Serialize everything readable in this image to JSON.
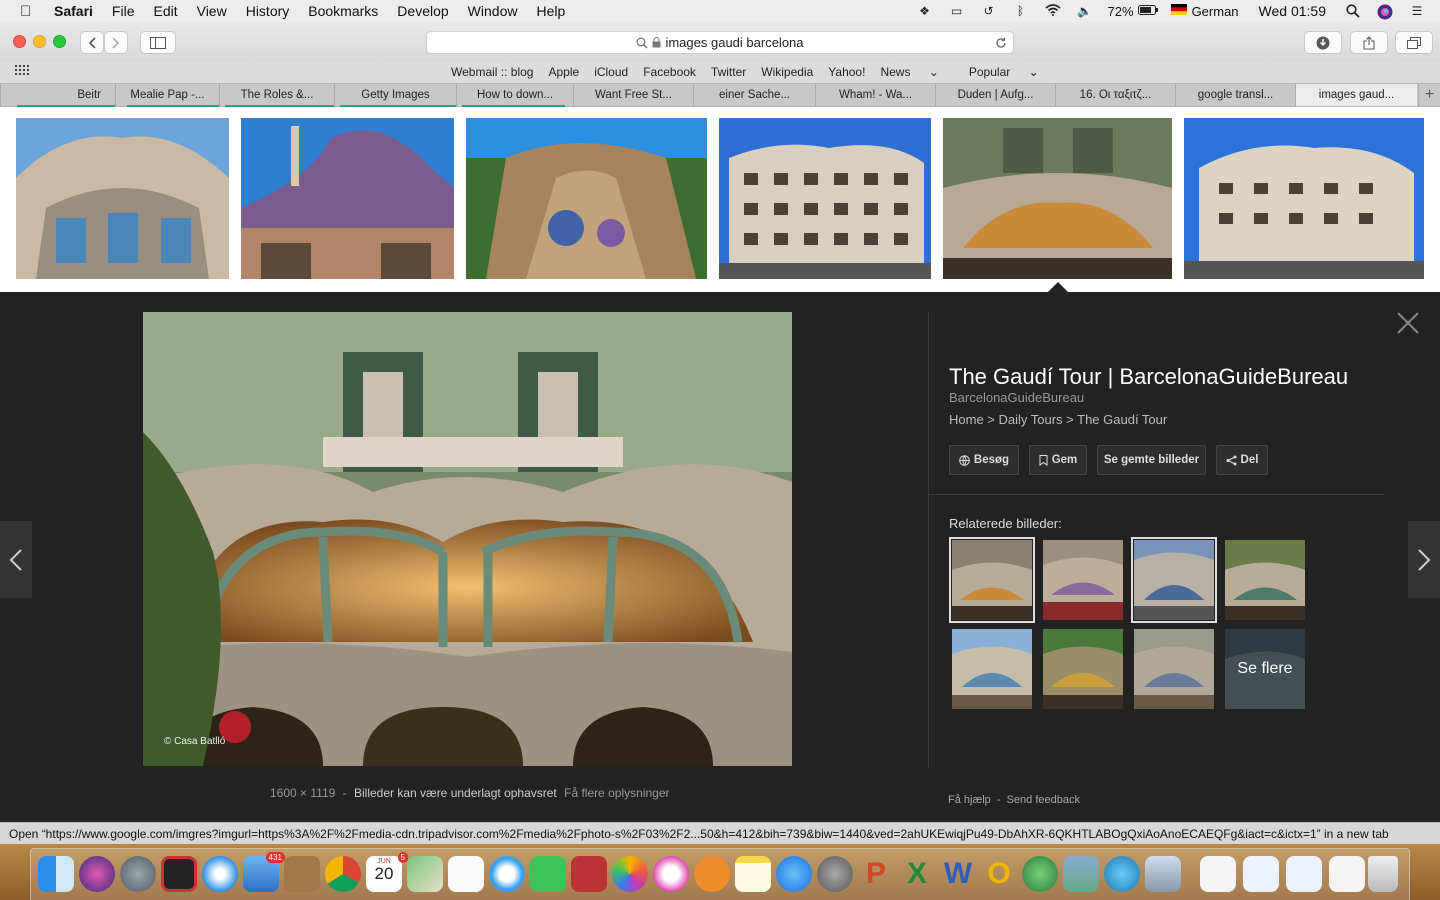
{
  "menubar": {
    "app": "Safari",
    "items": [
      "File",
      "Edit",
      "View",
      "History",
      "Bookmarks",
      "Develop",
      "Window",
      "Help"
    ],
    "battery": "72%",
    "input_source": "German",
    "clock": "Wed 01:59"
  },
  "toolbar": {
    "url_text": "images gaudi barcelona"
  },
  "favorites": [
    "Webmail :: blog",
    "Apple",
    "iCloud",
    "Facebook",
    "Twitter",
    "Wikipedia",
    "Yahoo!",
    "News",
    "Popular"
  ],
  "tabs": [
    "Beitr",
    "Mealie Pap -...",
    "The Roles &...",
    "Getty Images",
    "How to down...",
    "Want Free St...",
    "einer Sache...",
    "Wham! - Wa...",
    "Duden | Aufg...",
    "16. Οι ταξιτζ...",
    "google transl...",
    "images gaud..."
  ],
  "preview": {
    "title": "The Gaudí Tour | BarcelonaGuideBureau",
    "site": "BarcelonaGuideBureau",
    "breadcrumb": "Home > Daily Tours > The Gaudí Tour",
    "actions": {
      "visit": "Besøg",
      "save": "Gem",
      "saved": "Se gemte billeder",
      "share": "Del"
    },
    "related_label": "Relaterede billeder:",
    "see_more": "Se flere",
    "credit": "© Casa Batlló",
    "dimensions": "1600 × 1119",
    "info_sep": "-",
    "copyright_warning": "Billeder kan være underlagt ophavsret",
    "more_info": "Få flere oplysninger",
    "help": "Få hjælp",
    "help_sep": "-",
    "feedback": "Send feedback"
  },
  "status_bar": "Open “https://www.google.com/imgres?imgurl=https%3A%2F%2Fmedia-cdn.tripadvisor.com%2Fmedia%2Fphoto-s%2F03%2F2...50&h=412&bih=739&biw=1440&ved=2ahUKEwiqjPu49-DbAhXR-6QKHTLABOgQxiAoAnoECAEQFg&iact=c&ictx=1” in a new tab",
  "dock": {
    "mail_badge": "431",
    "calendar_month": "JUN",
    "calendar_day": "20",
    "calendar_badge": "5"
  }
}
